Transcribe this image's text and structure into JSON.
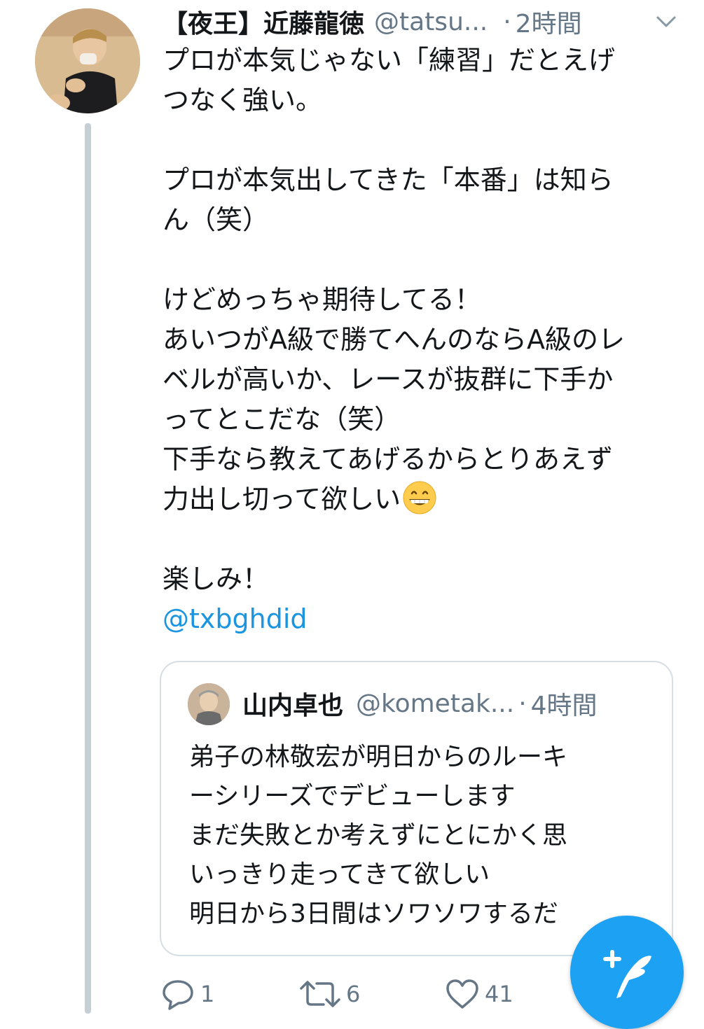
{
  "tweet": {
    "author_name": "【夜王】近藤龍徳",
    "author_handle": "@tatsu...",
    "separator": "·",
    "time": "2時間",
    "lines": [
      "プロが本気じゃない「練習」だとえげ",
      "つなく強い。",
      "",
      "プロが本気出してきた「本番」は知ら",
      "ん（笑）",
      "",
      "けどめっちゃ期待してる！",
      "あいつがA級で勝てへんのならA級のレ",
      "ベルが高いか、レースが抜群に下手か",
      "ってとこだな（笑）",
      "下手なら教えてあげるからとりあえず",
      "力出し切って欲しい",
      "",
      "楽しみ！"
    ],
    "emoji_name": "grinning-face-emoji",
    "mention": "@txbghdid"
  },
  "quote": {
    "author_name": "山内卓也",
    "author_handle": "@kometak...",
    "separator": "·",
    "time": "4時間",
    "lines": [
      "弟子の林敬宏が明日からのルーキ",
      "ーシリーズでデビューします",
      "まだ失敗とか考えずにとにかく思",
      "いっきり走ってきて欲しい",
      "明日から3日間はソワソワするだ"
    ]
  },
  "actions": {
    "reply_count": "1",
    "retweet_count": "6",
    "like_count": "41"
  },
  "icons": {
    "menu": "chevron-down-icon",
    "reply": "reply-icon",
    "retweet": "retweet-icon",
    "like": "heart-icon",
    "compose": "compose-tweet-icon"
  },
  "colors": {
    "link": "#1b95e0",
    "secondary_text": "#657786",
    "thread_line": "#c4cfd6",
    "fab": "#1da1f2",
    "border": "#d7dee3"
  }
}
